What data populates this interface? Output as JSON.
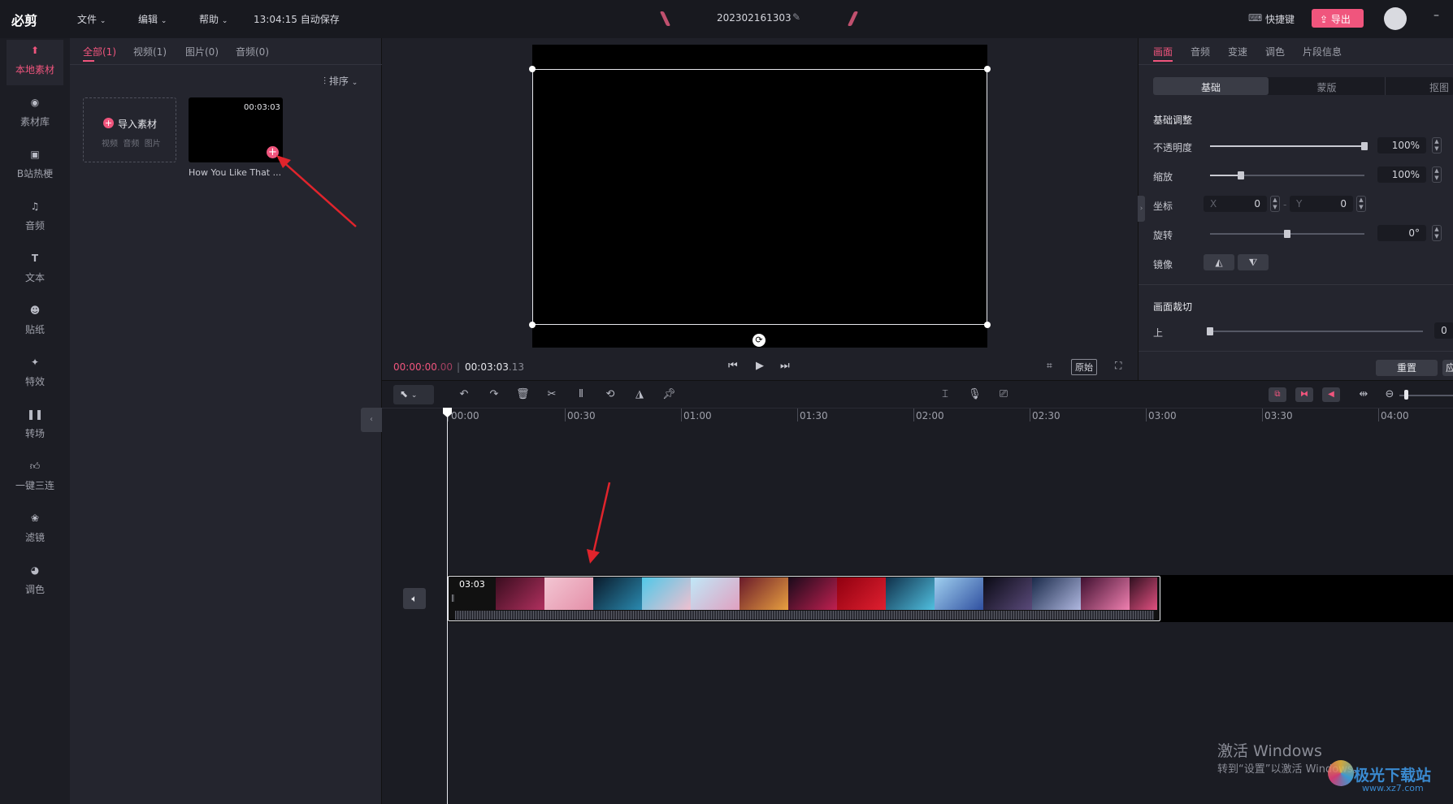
{
  "app": {
    "logo": "必剪",
    "menu": [
      "文件",
      "编辑",
      "帮助"
    ],
    "autosave": "13:04:15 自动保存",
    "project_name": "202302161303",
    "shortcut_label": "快捷键",
    "export_label": "导出"
  },
  "nav": [
    {
      "label": "本地素材",
      "icon": "upload-icon"
    },
    {
      "label": "素材库",
      "icon": "library-icon"
    },
    {
      "label": "B站热梗",
      "icon": "tv-icon"
    },
    {
      "label": "音频",
      "icon": "music-icon"
    },
    {
      "label": "文本",
      "icon": "text-icon"
    },
    {
      "label": "贴纸",
      "icon": "sticker-icon"
    },
    {
      "label": "特效",
      "icon": "star-icon"
    },
    {
      "label": "转场",
      "icon": "transition-icon"
    },
    {
      "label": "一键三连",
      "icon": "thumb-up-icon"
    },
    {
      "label": "滤镜",
      "icon": "filter-icon"
    },
    {
      "label": "调色",
      "icon": "palette-icon"
    }
  ],
  "media": {
    "tabs": [
      "全部(1)",
      "视频(1)",
      "图片(0)",
      "音频(0)"
    ],
    "sort_label": "排序",
    "import_label": "导入素材",
    "import_types": "视频  音频  图片",
    "clip_duration": "00:03:03",
    "clip_name": "How You Like That ..."
  },
  "player": {
    "current_time": "00:00:00",
    "current_frames": ".00",
    "total_time": "00:03:03",
    "total_frames": ".13",
    "ratio_label": "原始"
  },
  "props": {
    "tabs": [
      "画面",
      "音频",
      "变速",
      "调色",
      "片段信息"
    ],
    "subtabs": [
      "基础",
      "蒙版",
      "抠图"
    ],
    "section_basic": "基础调整",
    "opacity_label": "不透明度",
    "opacity_value": "100%",
    "opacity_level": 1.0,
    "scale_label": "缩放",
    "scale_value": "100%",
    "scale_level": 0.2,
    "position_label": "坐标",
    "x_label": "X",
    "x_value": "0",
    "y_label": "Y",
    "y_value": "0",
    "rotate_label": "旋转",
    "rotate_value": "0°",
    "rotate_level": 0.5,
    "mirror_label": "镜像",
    "section_crop": "画面裁切",
    "crop_top_label": "上",
    "crop_top_value": "0",
    "reset_label": "重置",
    "apply_label": "应"
  },
  "timeline": {
    "ticks": [
      "00:00",
      "00:30",
      "01:00",
      "01:30",
      "02:00",
      "02:30",
      "03:00",
      "03:30",
      "04:00"
    ],
    "clip_duration": "03:03"
  },
  "watermark": {
    "line1": "激活 Windows",
    "line2": "转到“设置”以激活 Windows。",
    "site": "极光下载站",
    "site_url": "www.xz7.com"
  },
  "colors": {
    "accent": "#f0557d",
    "export_bg": "#f0557d",
    "annotation_arrow": "#e0242c"
  }
}
